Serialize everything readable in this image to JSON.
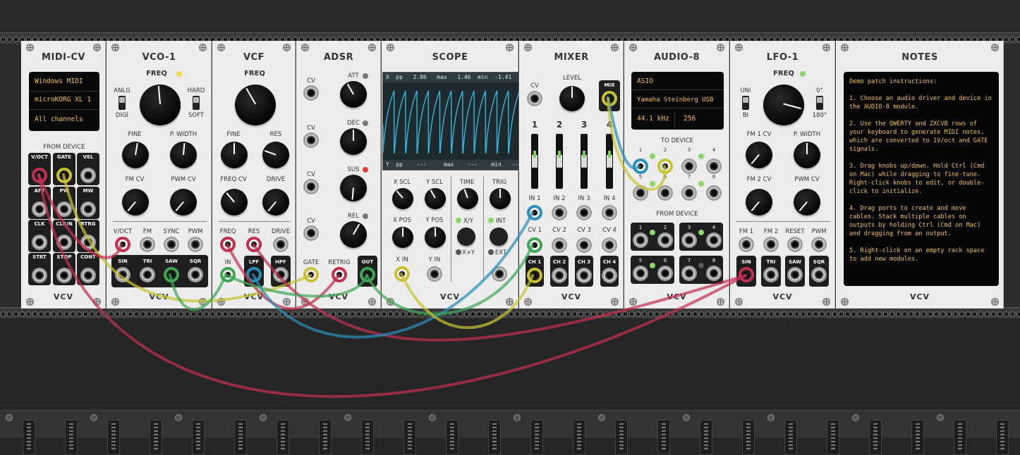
{
  "colors": {
    "yellow": "#c9c233",
    "green": "#3fa653",
    "red": "#c0304f",
    "blue": "#2b8fb8",
    "panel": "#ececec",
    "rail": "#3a3a3a",
    "display_text": "#f2c24a"
  },
  "brand": "VCV",
  "midi_cv": {
    "title": "MIDI-CV",
    "display": [
      "Windows MIDI",
      "microKORG XL 1",
      "All channels"
    ],
    "section": "FROM DEVICE",
    "ports": [
      "V/OCT",
      "GATE",
      "VEL",
      "AFT",
      "PW",
      "MW",
      "CLK",
      "CLK/N",
      "RTRG",
      "STRT",
      "STOP",
      "CONT"
    ]
  },
  "vco1": {
    "title": "VCO-1",
    "freq": "FREQ",
    "anlg": "ANLG",
    "digi": "DIGI",
    "hard": "HARD",
    "soft": "SOFT",
    "fine": "FINE",
    "pwidth": "P. WIDTH",
    "fmcv": "FM CV",
    "pwmcv": "PWM CV",
    "inputs": [
      "V/OCT",
      "FM",
      "SYNC",
      "PWM"
    ],
    "outputs": [
      "SIN",
      "TRI",
      "SAW",
      "SQR"
    ]
  },
  "vcf": {
    "title": "VCF",
    "freq": "FREQ",
    "fine": "FINE",
    "res": "RES",
    "freqcv": "FREQ CV",
    "drive": "DRIVE",
    "inputs": [
      "FREQ",
      "RES",
      "DRIVE"
    ],
    "in": "IN",
    "lpf": "LPF",
    "hpf": "HPF"
  },
  "adsr": {
    "title": "ADSR",
    "cv": "CV",
    "att": "ATT",
    "dec": "DEC",
    "sus": "SUS",
    "rel": "REL",
    "ports": [
      "GATE",
      "RETRIG",
      "OUT"
    ]
  },
  "scope": {
    "title": "SCOPE",
    "top_readout": {
      "ch": "X",
      "pp_lbl": "pp",
      "pp": "2.86",
      "max_lbl": "max",
      "max": "1.46",
      "min_lbl": "min",
      "min": "-1.41"
    },
    "bottom_readout": {
      "ch": "Y",
      "pp_lbl": "pp",
      "pp": "---",
      "max_lbl": "max",
      "max": "---",
      "min_lbl": "min",
      "min": "---"
    },
    "xscl": "X SCL",
    "yscl": "Y SCL",
    "time": "TIME",
    "trig": "TRIG",
    "xpos": "X POS",
    "ypos": "Y POS",
    "xy": "X/Y",
    "xplusy": "X+Y",
    "int": "INT",
    "ext": "EXT",
    "xin": "X IN",
    "yin": "Y IN"
  },
  "mixer": {
    "title": "MIXER",
    "cv": "CV",
    "level": "LEVEL",
    "mix": "MIX",
    "channels": [
      "1",
      "2",
      "3",
      "4"
    ],
    "ins": [
      "IN 1",
      "IN 2",
      "IN 3",
      "IN 4"
    ],
    "cvs": [
      "CV 1",
      "CV 2",
      "CV 3",
      "CV 4"
    ],
    "chs": [
      "CH 1",
      "CH 2",
      "CH 3",
      "CH 4"
    ]
  },
  "audio8": {
    "title": "AUDIO-8",
    "display": [
      "ASIO",
      "Yamaha Steinberg USB",
      "44.1 kHz",
      "256"
    ],
    "to_device": "TO DEVICE",
    "from_device": "FROM DEVICE",
    "to_nums": [
      "1",
      "2",
      "3",
      "4",
      "5",
      "6",
      "7",
      "8"
    ],
    "from_nums": [
      "1",
      "2",
      "3",
      "4",
      "5",
      "6",
      "7",
      "8"
    ]
  },
  "lfo1": {
    "title": "LFO-1",
    "freq": "FREQ",
    "uni": "UNI",
    "bi": "BI",
    "deg0": "0°",
    "deg180": "180°",
    "fm1cv": "FM 1 CV",
    "pwidth": "P. WIDTH",
    "fm2cv": "FM 2 CV",
    "pwmcv": "PWM CV",
    "inputs": [
      "FM 1",
      "FM 2",
      "RESET",
      "PWM"
    ],
    "outputs": [
      "SIN",
      "TRI",
      "SAW",
      "SQR"
    ]
  },
  "notes": {
    "title": "NOTES",
    "text": "Demo patch instructions:\n\n1. Choose an audio driver and device in the AUDIO-8 module.\n\n2. Use the QWERTY and ZXCVB rows of your keyboard to generate MIDI notes, which are converted to 1V/oct and GATE signals.\n\n3. Drag knobs up/down. Hold Ctrl (Cmd on Mac) while dragging to fine-tune. Right-click knobs to edit, or double-click to initialize.\n\n4. Drag ports to create and move cables. Stack multiple cables on outputs by holding Ctrl (Cmd on Mac) and dragging from an output.\n\n5. Right-click on an empty rack space to add new modules."
  }
}
